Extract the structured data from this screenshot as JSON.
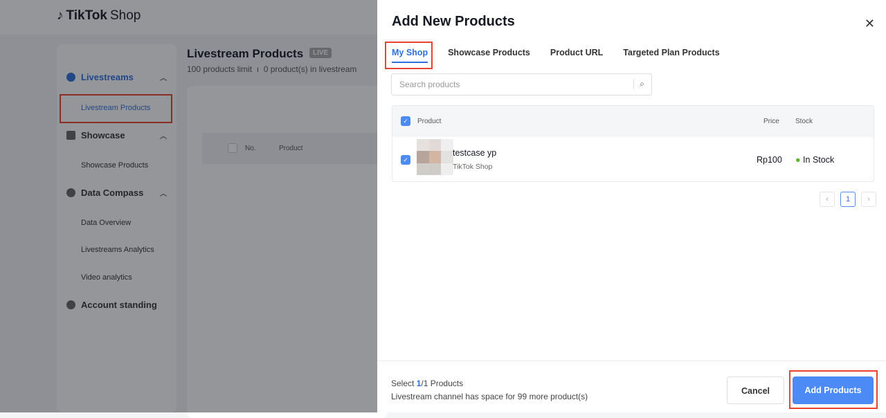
{
  "header": {
    "brand": "TikTok",
    "brand_suffix": "Shop"
  },
  "sidebar": {
    "groups": [
      {
        "label": "Livestreams",
        "items": [
          "Livestream Products"
        ]
      },
      {
        "label": "Showcase",
        "items": [
          "Showcase Products"
        ]
      },
      {
        "label": "Data Compass",
        "items": [
          "Data Overview",
          "Livestreams Analytics",
          "Video analytics"
        ]
      },
      {
        "label": "Account standing",
        "items": []
      }
    ]
  },
  "page": {
    "title": "Livestream Products",
    "live_badge": "LIVE",
    "limit": "100 products limit",
    "count": "0 product(s) in livestream",
    "columns": [
      "No.",
      "Product"
    ]
  },
  "drawer": {
    "title": "Add New Products",
    "tabs": [
      "My Shop",
      "Showcase Products",
      "Product URL",
      "Targeted Plan Products"
    ],
    "search_placeholder": "Search products",
    "columns": {
      "product": "Product",
      "price": "Price",
      "stock": "Stock"
    },
    "rows": [
      {
        "name": "testcase yp",
        "shop": "TikTok Shop",
        "price": "Rp100",
        "stock": "In Stock"
      }
    ],
    "pagination": {
      "current": "1"
    },
    "footer": {
      "select_prefix": "Select ",
      "selected": "1",
      "total": "/1 Products",
      "space": "Livestream channel has space for 99 more product(s)",
      "cancel": "Cancel",
      "add": "Add Products"
    }
  },
  "colors": {
    "accent": "#2f6fdc",
    "highlight": "#e8432e",
    "in_stock": "#5cb531"
  }
}
